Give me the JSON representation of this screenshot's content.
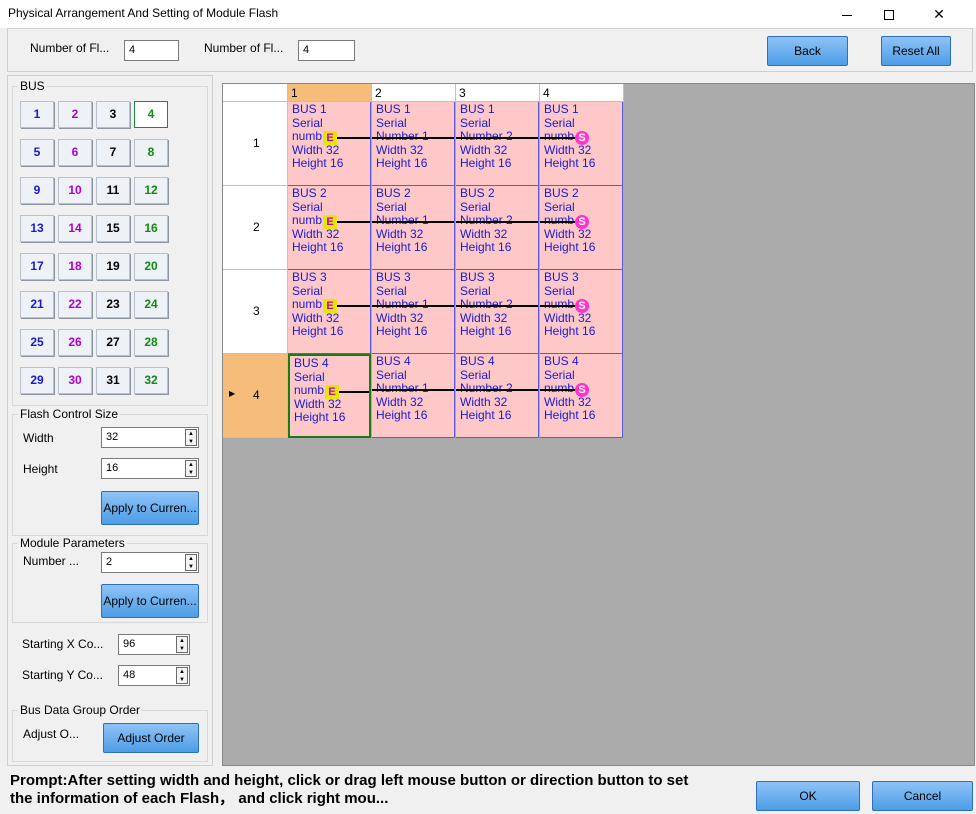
{
  "window": {
    "title": "Physical Arrangement And Setting of Module Flash",
    "minimize": "—",
    "close": "✕"
  },
  "top": {
    "label1": "Number of Fl...",
    "value1": "4",
    "label2": "Number of Fl...",
    "value2": "4",
    "back": "Back",
    "reset": "Reset All"
  },
  "bus": {
    "title": "BUS",
    "selected": 4,
    "buttons": [
      "1",
      "2",
      "3",
      "4",
      "5",
      "6",
      "7",
      "8",
      "9",
      "10",
      "11",
      "12",
      "13",
      "14",
      "15",
      "16",
      "17",
      "18",
      "19",
      "20",
      "21",
      "22",
      "23",
      "24",
      "25",
      "26",
      "27",
      "28",
      "29",
      "30",
      "31",
      "32"
    ],
    "colors": {
      "blue": "#1a1ad0",
      "purple": "#b000d0",
      "black": "#000000",
      "green": "#138a13"
    }
  },
  "flash": {
    "title": "Flash Control Size",
    "width_label": "Width",
    "width": "32",
    "height_label": "Height",
    "height": "16",
    "apply": "Apply to Curren..."
  },
  "module": {
    "title": "Module Parameters",
    "number_label": "Number ...",
    "number": "2",
    "apply": "Apply to Curren..."
  },
  "start": {
    "x_label": "Starting X Co...",
    "x": "96",
    "y_label": "Starting Y Co...",
    "y": "48"
  },
  "order": {
    "title": "Bus Data Group Order",
    "label": "Adjust O...",
    "button": "Adjust Order"
  },
  "grid": {
    "columns": [
      "1",
      "2",
      "3",
      "4"
    ],
    "rows": [
      {
        "label": "1",
        "cells": [
          [
            "BUS 1",
            "Serial",
            "numb",
            "Width 32",
            "Height 16"
          ],
          [
            "BUS 1",
            "Serial",
            "Number 1",
            "Width 32",
            "Height 16"
          ],
          [
            "BUS 1",
            "Serial",
            "Number 2",
            "Width 32",
            "Height 16"
          ],
          [
            "BUS 1",
            "Serial",
            "numb",
            "Width 32",
            "Height 16"
          ]
        ]
      },
      {
        "label": "2",
        "cells": [
          [
            "BUS 2",
            "Serial",
            "numb",
            "Width 32",
            "Height 16"
          ],
          [
            "BUS 2",
            "Serial",
            "Number 1",
            "Width 32",
            "Height 16"
          ],
          [
            "BUS 2",
            "Serial",
            "Number 2",
            "Width 32",
            "Height 16"
          ],
          [
            "BUS 2",
            "Serial",
            "numb",
            "Width 32",
            "Height 16"
          ]
        ]
      },
      {
        "label": "3",
        "cells": [
          [
            "BUS 3",
            "Serial",
            "numb",
            "Width 32",
            "Height 16"
          ],
          [
            "BUS 3",
            "Serial",
            "Number 1",
            "Width 32",
            "Height 16"
          ],
          [
            "BUS 3",
            "Serial",
            "Number 2",
            "Width 32",
            "Height 16"
          ],
          [
            "BUS 3",
            "Serial",
            "numb",
            "Width 32",
            "Height 16"
          ]
        ]
      },
      {
        "label": "4",
        "cells": [
          [
            "BUS 4",
            "Serial",
            "numb",
            "Width 32",
            "Height 16"
          ],
          [
            "BUS 4",
            "Serial",
            "Number 1",
            "Width 32",
            "Height 16"
          ],
          [
            "BUS 4",
            "Serial",
            "Number 2",
            "Width 32",
            "Height 16"
          ],
          [
            "BUS 4",
            "Serial",
            "numb",
            "Width 32",
            "Height 16"
          ]
        ]
      }
    ],
    "start_marker": "E",
    "end_marker": "S",
    "active_row": 4,
    "active_col": 1,
    "row_pointer": "▶"
  },
  "prompt": "Prompt:After setting width and height, click or drag left mouse button or direction button to set the information of each Flash， and click right mou...",
  "ok": "OK",
  "cancel": "Cancel"
}
